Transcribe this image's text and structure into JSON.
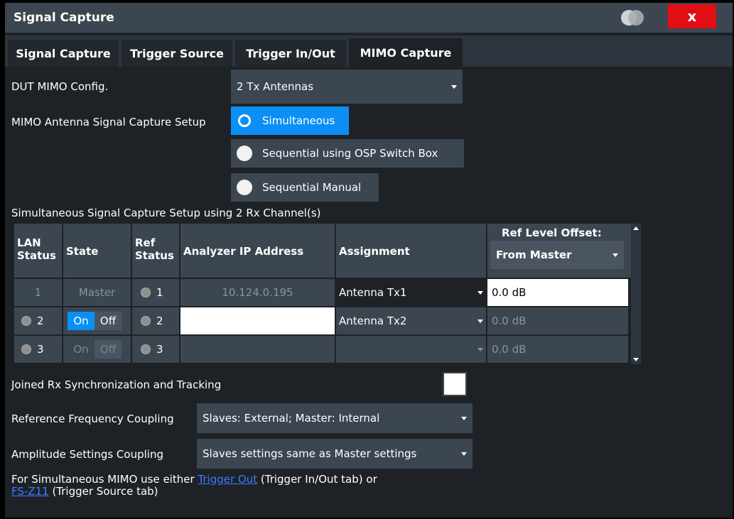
{
  "window": {
    "title": "Signal Capture",
    "close_label": "x"
  },
  "tabs": [
    {
      "label": "Signal Capture"
    },
    {
      "label": "Trigger Source"
    },
    {
      "label": "Trigger In/Out"
    },
    {
      "label": "MIMO Capture"
    }
  ],
  "dut_config": {
    "label": "DUT MIMO Config.",
    "value": "2 Tx Antennas"
  },
  "capture_setup": {
    "label": "MIMO Antenna Signal Capture Setup",
    "options": [
      {
        "label": "Simultaneous",
        "selected": true
      },
      {
        "label": "Sequential using OSP Switch Box",
        "selected": false
      },
      {
        "label": "Sequential Manual",
        "selected": false
      }
    ]
  },
  "table_section": {
    "title": "Simultaneous Signal Capture Setup using 2 Rx Channel(s)",
    "headers": {
      "lan_status": "LAN Status",
      "state": "State",
      "ref_status": "Ref Status",
      "ip": "Analyzer IP Address",
      "assignment": "Assignment",
      "ref_offset": "Ref Level Offset:",
      "ref_offset_mode": "From Master"
    },
    "rows": [
      {
        "lan": "1",
        "state": "Master",
        "ref": "1",
        "ip": "10.124.0.195",
        "assignment": "Antenna Tx1",
        "offset": "0.0 dB"
      },
      {
        "lan": "2",
        "on": "On",
        "off": "Off",
        "ref": "2",
        "ip": "",
        "assignment": "Antenna Tx2",
        "offset": "0.0 dB"
      },
      {
        "lan": "3",
        "on": "On",
        "off": "Off",
        "ref": "3",
        "ip": "",
        "assignment": "",
        "offset": "0.0 dB"
      }
    ]
  },
  "joined_rx": {
    "label": "Joined Rx Synchronization and Tracking",
    "checked": false
  },
  "ref_freq": {
    "label": "Reference Frequency Coupling",
    "value": "Slaves: External; Master: Internal"
  },
  "amplitude": {
    "label": "Amplitude Settings Coupling",
    "value": "Slaves settings same as Master settings"
  },
  "note": {
    "prefix": "For Simultaneous MIMO use either ",
    "link1": "Trigger Out",
    "mid": " (Trigger In/Out tab) or",
    "link2": "FS-Z11",
    "suffix": " (Trigger Source tab)"
  },
  "colors": {
    "accent": "#0b8ff5",
    "close": "#e10e16",
    "panel": "#3b4651"
  }
}
